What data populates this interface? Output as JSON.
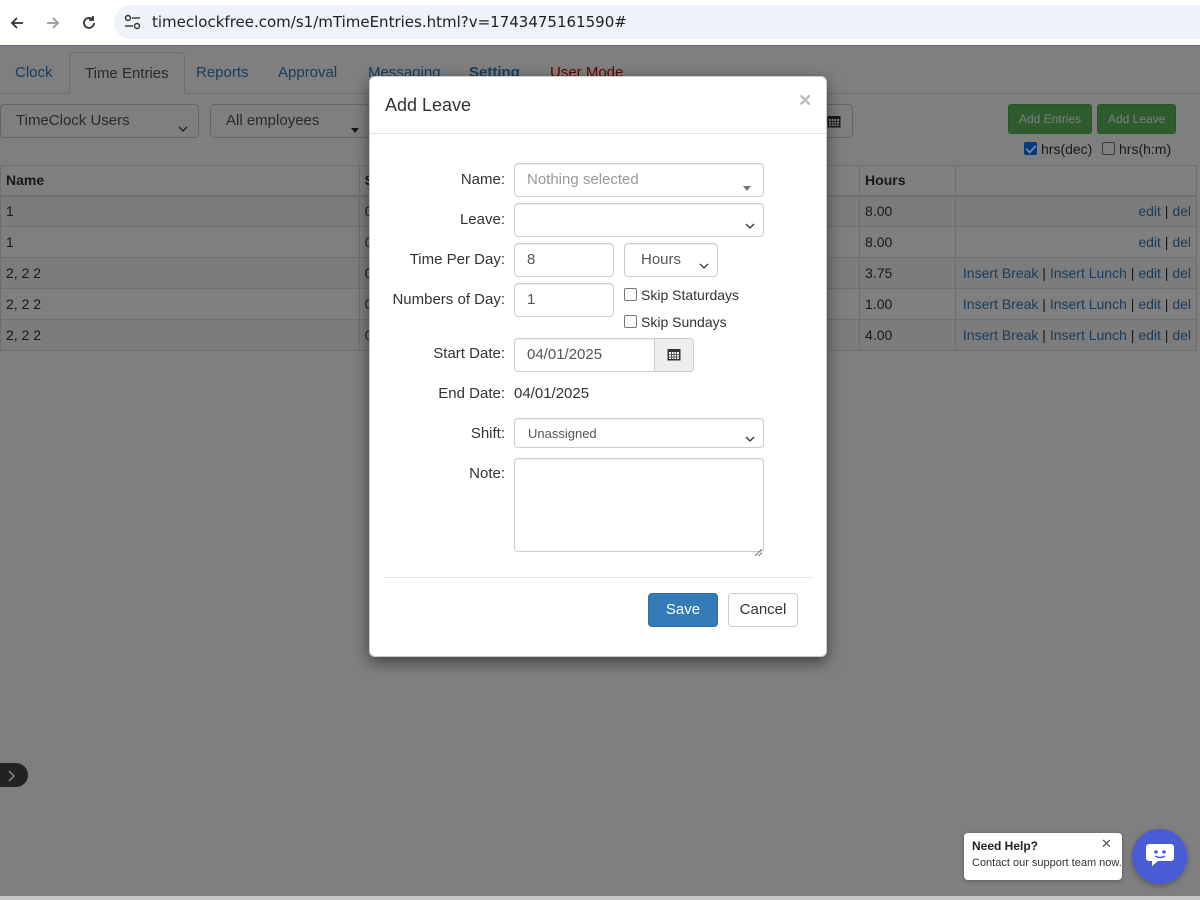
{
  "browser": {
    "url": "timeclockfree.com/s1/mTimeEntries.html?v=1743475161590#"
  },
  "tabs": [
    {
      "label": "Clock"
    },
    {
      "label": "Time Entries"
    },
    {
      "label": "Reports"
    },
    {
      "label": "Approval"
    },
    {
      "label": "Messaging"
    },
    {
      "label": "Setting"
    },
    {
      "label": "User Mode"
    }
  ],
  "filters": {
    "user_group": "TimeClock Users",
    "employees": "All employees"
  },
  "toolbar": {
    "add_entries": "Add Entries",
    "add_leave": "Add Leave",
    "hrs_dec_label": "hrs(dec)",
    "hrs_dec_checked": true,
    "hrs_hm_label": "hrs(h:m)",
    "hrs_hm_checked": false
  },
  "table": {
    "columns": [
      "Name",
      "S",
      "Hours",
      ""
    ],
    "rows": [
      {
        "name": "1",
        "s": "0",
        "hours": "8.00",
        "actions": [
          "edit",
          "del"
        ]
      },
      {
        "name": "1",
        "s": "0",
        "hours": "8.00",
        "actions": [
          "edit",
          "del"
        ]
      },
      {
        "name": "2, 2 2",
        "s": "0",
        "hours": "3.75",
        "actions": [
          "Insert Break",
          "Insert Lunch",
          "edit",
          "del"
        ]
      },
      {
        "name": "2, 2 2",
        "s": "0",
        "hours": "1.00",
        "actions": [
          "Insert Break",
          "Insert Lunch",
          "edit",
          "del"
        ]
      },
      {
        "name": "2, 2 2",
        "s": "0",
        "hours": "4.00",
        "actions": [
          "Insert Break",
          "Insert Lunch",
          "edit",
          "del"
        ]
      }
    ]
  },
  "modal": {
    "title": "Add Leave",
    "close": "×",
    "name_label": "Name:",
    "name_placeholder": "Nothing selected",
    "leave_label": "Leave:",
    "leave_value": "",
    "time_per_day_label": "Time Per Day:",
    "time_per_day_value": "8",
    "time_unit": "Hours",
    "numbers_of_day_label": "Numbers of Day:",
    "numbers_of_day_value": "1",
    "skip_saturdays_label": "Skip Staturdays",
    "skip_sundays_label": "Skip Sundays",
    "start_date_label": "Start Date:",
    "start_date_value": "04/01/2025",
    "end_date_label": "End Date:",
    "end_date_value": "04/01/2025",
    "shift_label": "Shift:",
    "shift_value": "Unassigned",
    "note_label": "Note:",
    "note_value": "",
    "save": "Save",
    "cancel": "Cancel"
  },
  "help": {
    "title": "Need Help?",
    "subtitle": "Contact our support team now.",
    "close": "✕"
  },
  "colors": {
    "accent": "#337ab7",
    "success": "#5cb85c",
    "danger": "#cc0000",
    "help_button": "#4a5bd6"
  }
}
